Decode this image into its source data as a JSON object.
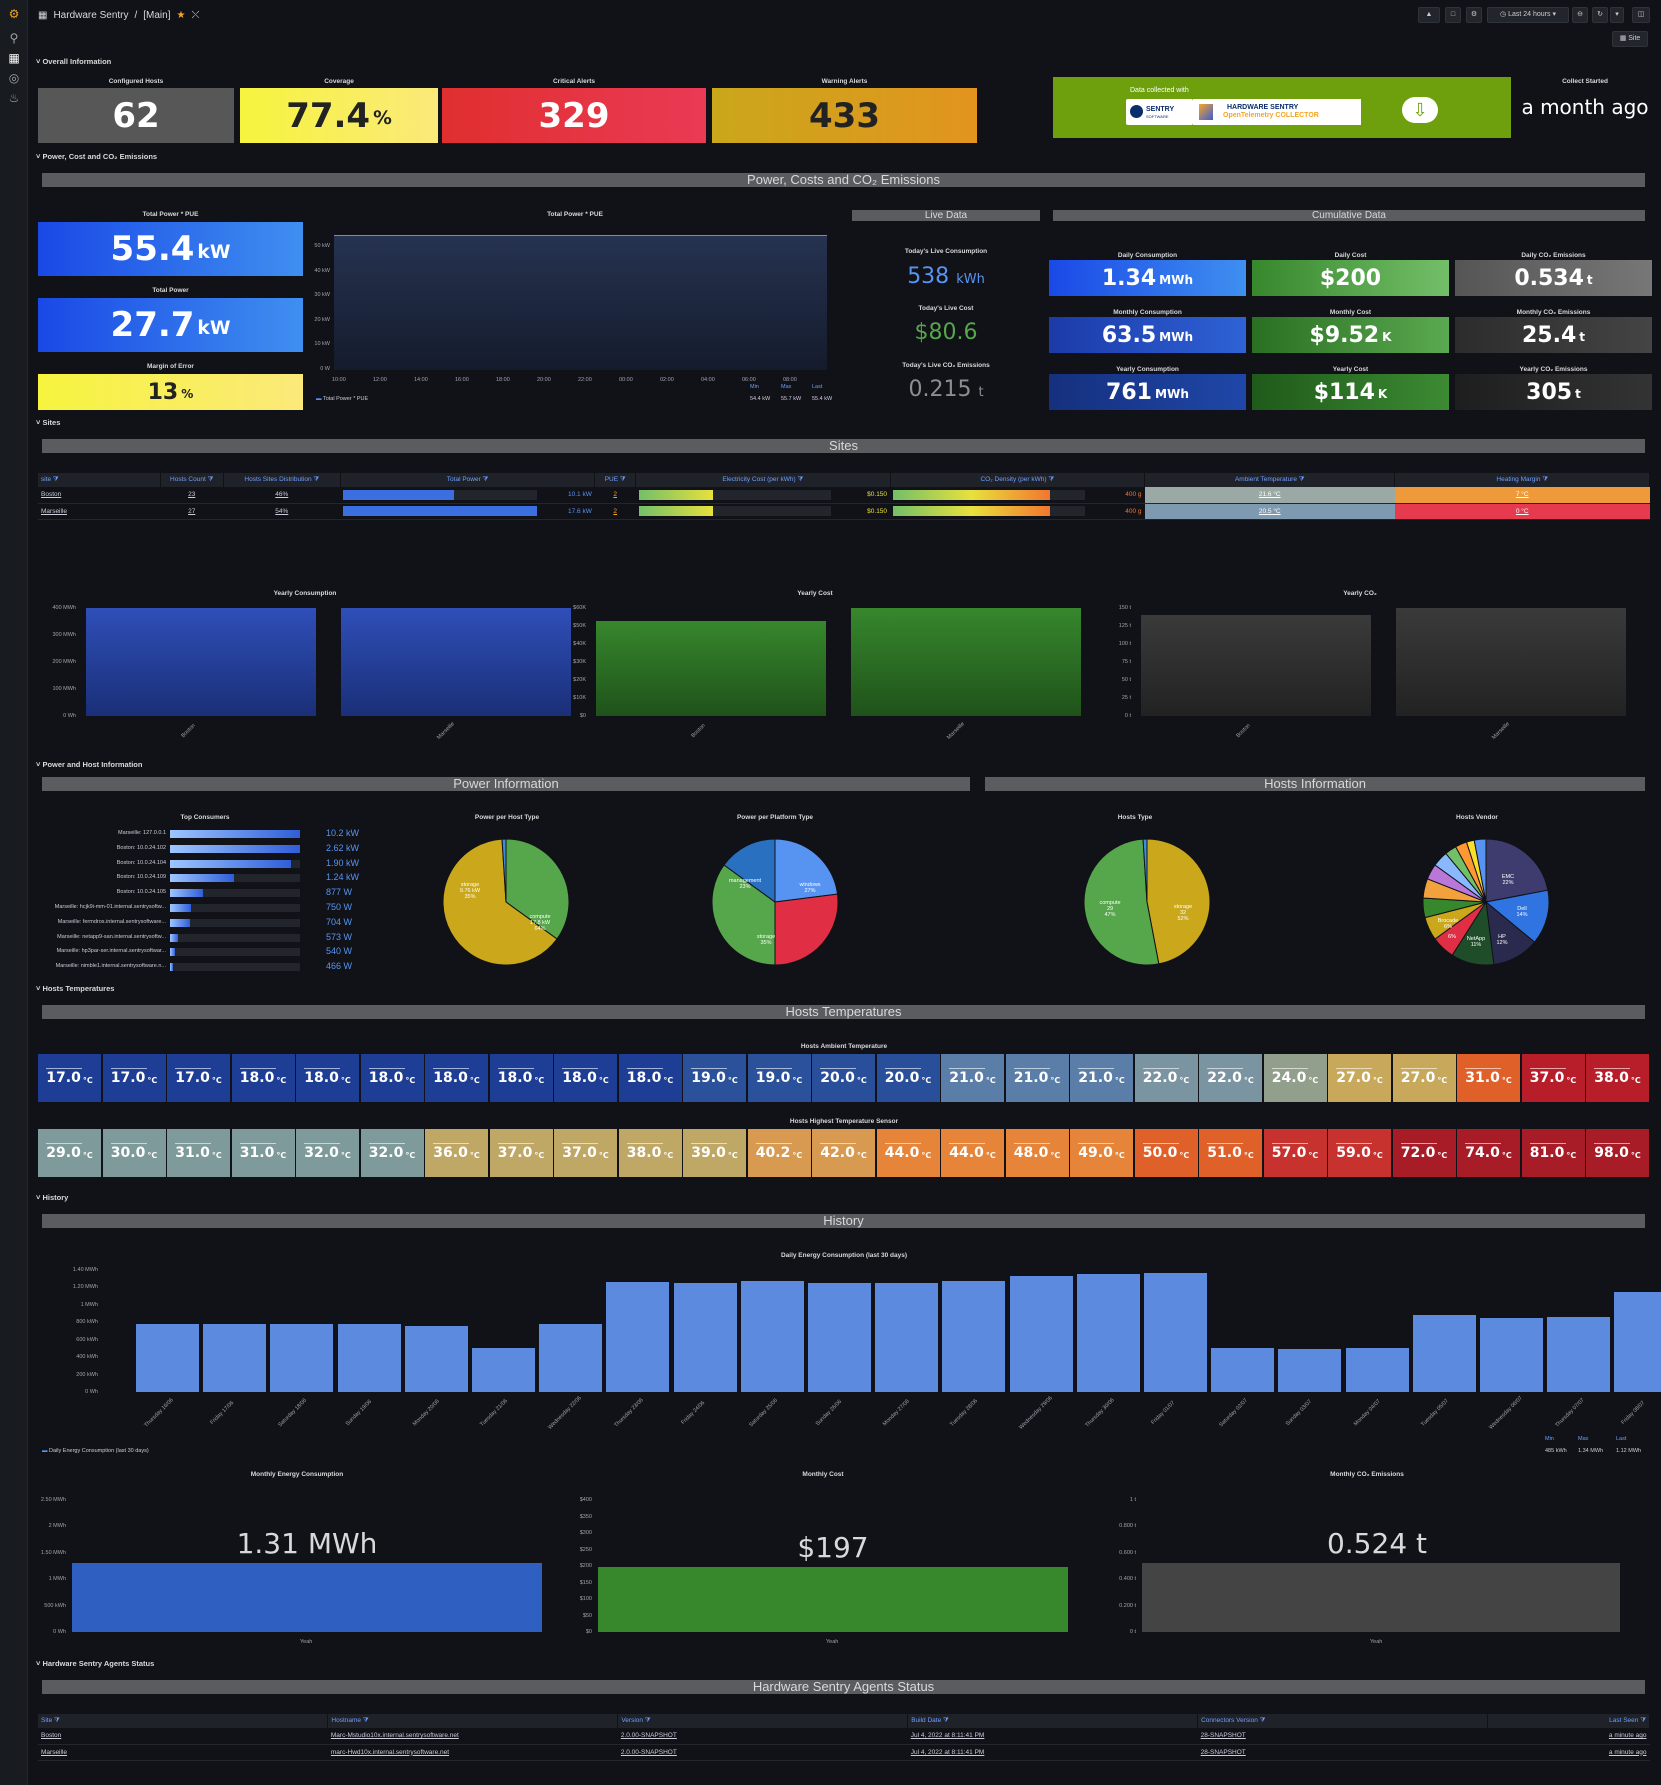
{
  "breadcrumb": {
    "app": "Hardware Sentry",
    "sep": "/",
    "page": "[Main]"
  },
  "toolbar": {
    "time_range": "Last 24 hours",
    "site_filter": "Site"
  },
  "rows": {
    "overall": "Overall Information",
    "power": "Power, Cost and CO₂ Emissions",
    "sites": "Sites",
    "power_host": "Power and Host Information",
    "temps": "Hosts Temperatures",
    "history": "History",
    "agents": "Hardware Sentry Agents Status"
  },
  "overall": {
    "configured_hosts": {
      "title": "Configured Hosts",
      "value": "62"
    },
    "coverage": {
      "title": "Coverage",
      "value": "77.4",
      "unit": "%"
    },
    "critical": {
      "title": "Critical Alerts",
      "value": "329"
    },
    "warning": {
      "title": "Warning Alerts",
      "value": "433"
    },
    "banner": {
      "collected": "Data collected with",
      "sentry1": "SENTRY",
      "sentry2": "SOFTWARE",
      "hs1": "HARDWARE SENTRY",
      "hs2": "OpenTelemetry COLLECTOR"
    },
    "collect_started": {
      "title": "Collect Started",
      "value": "a month ago"
    }
  },
  "power": {
    "section": "Power, Costs and CO₂ Emissions",
    "total_pue": {
      "title": "Total Power * PUE",
      "value": "55.4",
      "unit": "kW"
    },
    "total_power": {
      "title": "Total Power",
      "value": "27.7",
      "unit": "kW"
    },
    "margin": {
      "title": "Margin of Error",
      "value": "13",
      "unit": "%"
    },
    "chart": {
      "title": "Total Power * PUE",
      "yticks": [
        "50 kW",
        "40 kW",
        "30 kW",
        "20 kW",
        "10 kW",
        "0 W"
      ],
      "xticks": [
        "10:00",
        "12:00",
        "14:00",
        "16:00",
        "18:00",
        "20:00",
        "22:00",
        "00:00",
        "02:00",
        "04:00",
        "06:00",
        "08:00"
      ],
      "legend": "Total Power * PUE",
      "min_l": "Min",
      "max_l": "Max",
      "last_l": "Last",
      "min": "54.4 kW",
      "max": "55.7 kW",
      "last": "55.4 kW"
    },
    "live": {
      "header": "Live Data",
      "cons_t": "Today's Live Consumption",
      "cons": "538",
      "cons_u": "kWh",
      "cost_t": "Today's Live Cost",
      "cost": "$80.6",
      "co2_t": "Today's Live CO₂ Emissions",
      "co2": "0.215",
      "co2_u": "t"
    },
    "cumul": {
      "header": "Cumulative Data",
      "dc_t": "Daily Consumption",
      "dc": "1.34",
      "dc_u": "MWh",
      "dcost_t": "Daily Cost",
      "dcost": "$200",
      "dco2_t": "Daily CO₂ Emissions",
      "dco2": "0.534",
      "dco2_u": "t",
      "mc_t": "Monthly Consumption",
      "mc": "63.5",
      "mc_u": "MWh",
      "mcost_t": "Monthly Cost",
      "mcost": "$9.52",
      "mcost_u": "K",
      "mco2_t": "Monthly CO₂ Emissions",
      "mco2": "25.4",
      "mco2_u": "t",
      "yc_t": "Yearly Consumption",
      "yc": "761",
      "yc_u": "MWh",
      "ycost_t": "Yearly Cost",
      "ycost": "$114",
      "ycost_u": "K",
      "yco2_t": "Yearly CO₂ Emissions",
      "yco2": "305",
      "yco2_u": "t"
    }
  },
  "sites": {
    "section": "Sites",
    "headers": [
      "site",
      "Hosts Count",
      "Hosts Sites Distribution",
      "Total Power",
      "PUE",
      "Electricity Cost (per kWh)",
      "CO₂ Density (per kWh)",
      "Ambient Temperature",
      "Heating Margin"
    ],
    "rows": [
      {
        "site": "Boston",
        "count": "23",
        "dist": "46%",
        "power": "10.1 kW",
        "power_frac": 0.57,
        "pue": "2",
        "cost": "$0.150",
        "co2": "400 g",
        "amb": "21.6 °C",
        "heat": "7 °C"
      },
      {
        "site": "Marseille",
        "count": "27",
        "dist": "54%",
        "power": "17.6 kW",
        "power_frac": 1.0,
        "pue": "2",
        "cost": "$0.150",
        "co2": "400 g",
        "amb": "20.5 °C",
        "heat": "0 °C"
      }
    ],
    "charts": [
      {
        "title": "Yearly Consumption",
        "yticks": [
          "400 MWh",
          "300 MWh",
          "200 MWh",
          "100 MWh",
          "0 Wh"
        ],
        "ymax": 400,
        "values": [
          400,
          400
        ],
        "cats": [
          "Boston",
          "Marseille"
        ],
        "color": "#2f4fb8"
      },
      {
        "title": "Yearly Cost",
        "yticks": [
          "$60K",
          "$50K",
          "$40K",
          "$30K",
          "$20K",
          "$10K",
          "$0"
        ],
        "ymax": 60,
        "values": [
          53,
          60
        ],
        "cats": [
          "Boston",
          "Marseille"
        ],
        "color": "#37872d"
      },
      {
        "title": "Yearly CO₂",
        "yticks": [
          "150 t",
          "125 t",
          "100 t",
          "75 t",
          "50 t",
          "25 t",
          "0 t"
        ],
        "ymax": 150,
        "values": [
          140,
          150
        ],
        "cats": [
          "Boston",
          "Marseille"
        ],
        "color": "#3a3a3a"
      }
    ]
  },
  "power_info": {
    "section": "Power Information",
    "hosts_section": "Hosts Information",
    "top_title": "Top Consumers",
    "top": [
      {
        "name": "Marseille: 127.0.0.1",
        "value": "10.2 kW",
        "frac": 1.0
      },
      {
        "name": "Boston: 10.0.24.102",
        "value": "2.62 kW",
        "frac": 1.0
      },
      {
        "name": "Boston: 10.0.24.104",
        "value": "1.90 kW",
        "frac": 0.93
      },
      {
        "name": "Boston: 10.0.24.109",
        "value": "1.24 kW",
        "frac": 0.49
      },
      {
        "name": "Boston: 10.0.24.105",
        "value": "877 W",
        "frac": 0.25
      },
      {
        "name": "Marseille: hcjk9i-mm-01.internal.sentrysoftw...",
        "value": "750 W",
        "frac": 0.16
      },
      {
        "name": "Marseille: fermdros.internal.sentrysoftware...",
        "value": "704 W",
        "frac": 0.15
      },
      {
        "name": "Marseille: netapp9-san.internal.sentrysoftw...",
        "value": "573 W",
        "frac": 0.06
      },
      {
        "name": "Marseille: hp3par-ser.internal.sentrysoftwar...",
        "value": "540 W",
        "frac": 0.04
      },
      {
        "name": "Marseille: nimble1.internal.sentrysoftware.n...",
        "value": "466 W",
        "frac": 0.02
      }
    ],
    "pies": [
      {
        "title": "Power per Host Type",
        "labels": [
          "storage\n9.76 kW\n35%",
          "compute\n17.8 kW\n64%"
        ]
      },
      {
        "title": "Power per Platform Type",
        "labels": [
          "management\n23%",
          "windows\n27%",
          "storage\n35%"
        ]
      },
      {
        "title": "Hosts Type",
        "labels": [
          "compute\n29\n47%",
          "storage\n32\n52%"
        ]
      },
      {
        "title": "Hosts Vendor",
        "labels": [
          "EMC\n22%",
          "Dell\n14%",
          "HP\n12%",
          "NetApp\n11%",
          "6%",
          "Brocade\n6%"
        ]
      }
    ]
  },
  "temps": {
    "section": "Hosts Temperatures",
    "ambient_title": "Hosts Ambient Temperature",
    "ambient": [
      "17.0",
      "17.0",
      "17.0",
      "18.0",
      "18.0",
      "18.0",
      "18.0",
      "18.0",
      "18.0",
      "18.0",
      "19.0",
      "19.0",
      "20.0",
      "20.0",
      "21.0",
      "21.0",
      "21.0",
      "22.0",
      "22.0",
      "24.0",
      "27.0",
      "27.0",
      "31.0",
      "37.0",
      "38.0"
    ],
    "highest_title": "Hosts Highest Temperature Sensor",
    "highest": [
      "29.0",
      "30.0",
      "31.0",
      "31.0",
      "32.0",
      "32.0",
      "36.0",
      "37.0",
      "37.0",
      "38.0",
      "39.0",
      "40.2",
      "42.0",
      "44.0",
      "44.0",
      "48.0",
      "49.0",
      "50.0",
      "51.0",
      "57.0",
      "59.0",
      "72.0",
      "74.0",
      "81.0",
      "98.0"
    ],
    "unit": "°C"
  },
  "history": {
    "section": "History",
    "daily": {
      "title": "Daily Energy Consumption (last 30 days)",
      "yticks": [
        "1.40 MWh",
        "1.20 MWh",
        "1 MWh",
        "800 kWh",
        "600 kWh",
        "400 kWh",
        "200 kWh",
        "0 Wh"
      ],
      "ymax": 1.4,
      "values": [
        0.78,
        0.78,
        0.78,
        0.78,
        0.76,
        0.5,
        0.78,
        1.26,
        1.25,
        1.27,
        1.25,
        1.25,
        1.27,
        1.33,
        1.35,
        1.36,
        0.51,
        0.49,
        0.5,
        0.88,
        0.85,
        0.86,
        1.15
      ],
      "cats": [
        "Thursday 16/06",
        "Friday 17/06",
        "Saturday 18/06",
        "Sunday 19/06",
        "Monday 20/06",
        "Tuesday 21/06",
        "Wednesday 22/06",
        "Thursday 23/06",
        "Friday 24/06",
        "Saturday 25/06",
        "Sunday 26/06",
        "Monday 27/06",
        "Tuesday 28/06",
        "Wednesday 29/06",
        "Thursday 30/06",
        "Friday 01/07",
        "Saturday 02/07",
        "Sunday 03/07",
        "Monday 04/07",
        "Tuesday 05/07",
        "Wednesday 06/07",
        "Thursday 07/07",
        "Friday 08/07"
      ],
      "legend": "Daily Energy Consumption (last 30 days)",
      "min_l": "Min",
      "max_l": "Max",
      "last_l": "Last",
      "min": "485 kWh",
      "max": "1.34 MWh",
      "last": "1.12 MWh"
    },
    "monthly": [
      {
        "title": "Monthly Energy Consumption",
        "value": "1.31 MWh",
        "yticks": [
          "2.50 MWh",
          "2 MWh",
          "1.50 MWh",
          "1 MWh",
          "500 kWh",
          "0 Wh"
        ],
        "ymax": 2.5,
        "v": 1.31,
        "color": "#2e5fc1",
        "cat": "Yeah"
      },
      {
        "title": "Monthly Cost",
        "value": "$197",
        "yticks": [
          "$400",
          "$350",
          "$300",
          "$250",
          "$200",
          "$150",
          "$100",
          "$50",
          "$0"
        ],
        "ymax": 400,
        "v": 197,
        "color": "#37872d",
        "cat": "Yeah"
      },
      {
        "title": "Monthly CO₂ Emissions",
        "value": "0.524 t",
        "yticks": [
          "1 t",
          "0.800 t",
          "0.600 t",
          "0.400 t",
          "0.200 t",
          "0 t"
        ],
        "ymax": 1,
        "v": 0.524,
        "color": "#444",
        "cat": "Yeah"
      }
    ]
  },
  "agents": {
    "section": "Hardware Sentry Agents Status",
    "headers": [
      "Site",
      "Hostname",
      "Version",
      "Build Date",
      "Connectors Version",
      "Last Seen"
    ],
    "rows": [
      [
        "Boston",
        "Marc-Mstudio10x.internal.sentrysoftware.net",
        "2.0.00-SNAPSHOT",
        "Jul 4, 2022 at 8:11:41 PM",
        "28-SNAPSHOT",
        "a minute ago"
      ],
      [
        "Marseille",
        "marc-Hwd10x.internal.sentrysoftware.net",
        "2.0.00-SNAPSHOT",
        "Jul 4, 2022 at 8:11:41 PM",
        "28-SNAPSHOT",
        "a minute ago"
      ]
    ]
  }
}
